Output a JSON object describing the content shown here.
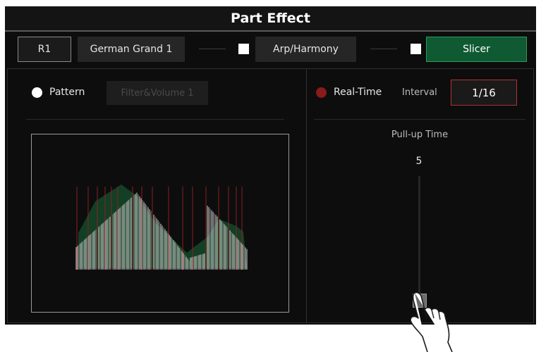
{
  "window": {
    "title": "Part Effect"
  },
  "toolbar": {
    "part": "R1",
    "voice": "German Grand 1",
    "arp_label": "Arp/Harmony",
    "slicer_label": "Slicer"
  },
  "pattern": {
    "label": "Pattern",
    "value": "Filter&Volume 1"
  },
  "realtime": {
    "label": "Real-Time",
    "interval_label": "Interval",
    "interval_value": "1/16"
  },
  "pullup": {
    "label": "Pull-up Time",
    "value": "5"
  },
  "colors": {
    "accent_green": "#0f5a32",
    "accent_red": "#b23030",
    "realtime_radio": "#8b1a1a"
  },
  "icons": [
    "checkbox-icon",
    "radio-icon",
    "pointing-hand-icon"
  ]
}
